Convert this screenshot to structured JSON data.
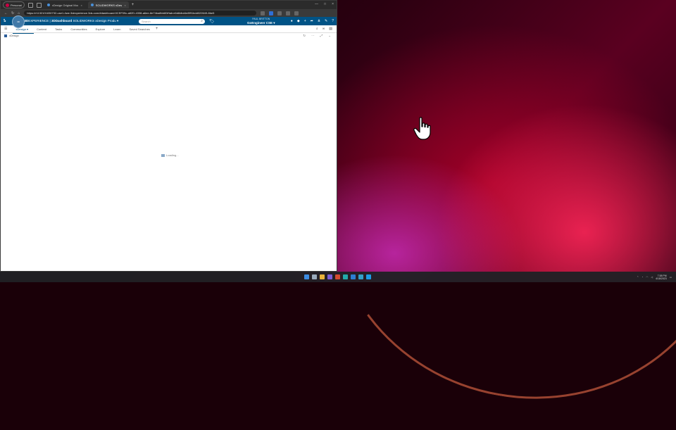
{
  "browser": {
    "profile_label": "Personal",
    "tabs": [
      {
        "label": "xDesign Original Model",
        "active": false
      },
      {
        "label": "SOLIDWORKS xDesign Produ",
        "active": true
      }
    ],
    "new_tab": "+",
    "url": "https://r1132101830732-use1-4we.3dexperience.3ds.com/#dashboard:0CEF09c-a82D-4338-a6ee-8e74ba8bb80f/tab:e6d8dbd4e8f91bdd022649-8be5"
  },
  "appbar": {
    "brand_prefix": "3D",
    "brand_experience": "EXPERIENCE",
    "brand_separator": " | ",
    "brand_dashboard": "3DDashboard",
    "app_title": " SOLIDWORKS xDesign Produ ▾",
    "search_placeholder": "Search",
    "user_role": "PAUL BRITTON",
    "user_name": "GoEngineer CSE ▾",
    "compass_label": "3D"
  },
  "dashboard_tabs": [
    {
      "label": "xDesign ▾",
      "active": true
    },
    {
      "label": "Content",
      "active": false
    },
    {
      "label": "Tasks",
      "active": false
    },
    {
      "label": "Communities",
      "active": false
    },
    {
      "label": "Explore",
      "active": false
    },
    {
      "label": "Learn",
      "active": false
    },
    {
      "label": "Saved Searches",
      "active": false
    }
  ],
  "widget": {
    "title": "xDesign",
    "loading_text": "Loading..."
  },
  "taskbar": {
    "time": "7:38 PM",
    "date": "4/18/2023"
  },
  "colors": {
    "appbar": "#005386",
    "accent": "#005386"
  }
}
